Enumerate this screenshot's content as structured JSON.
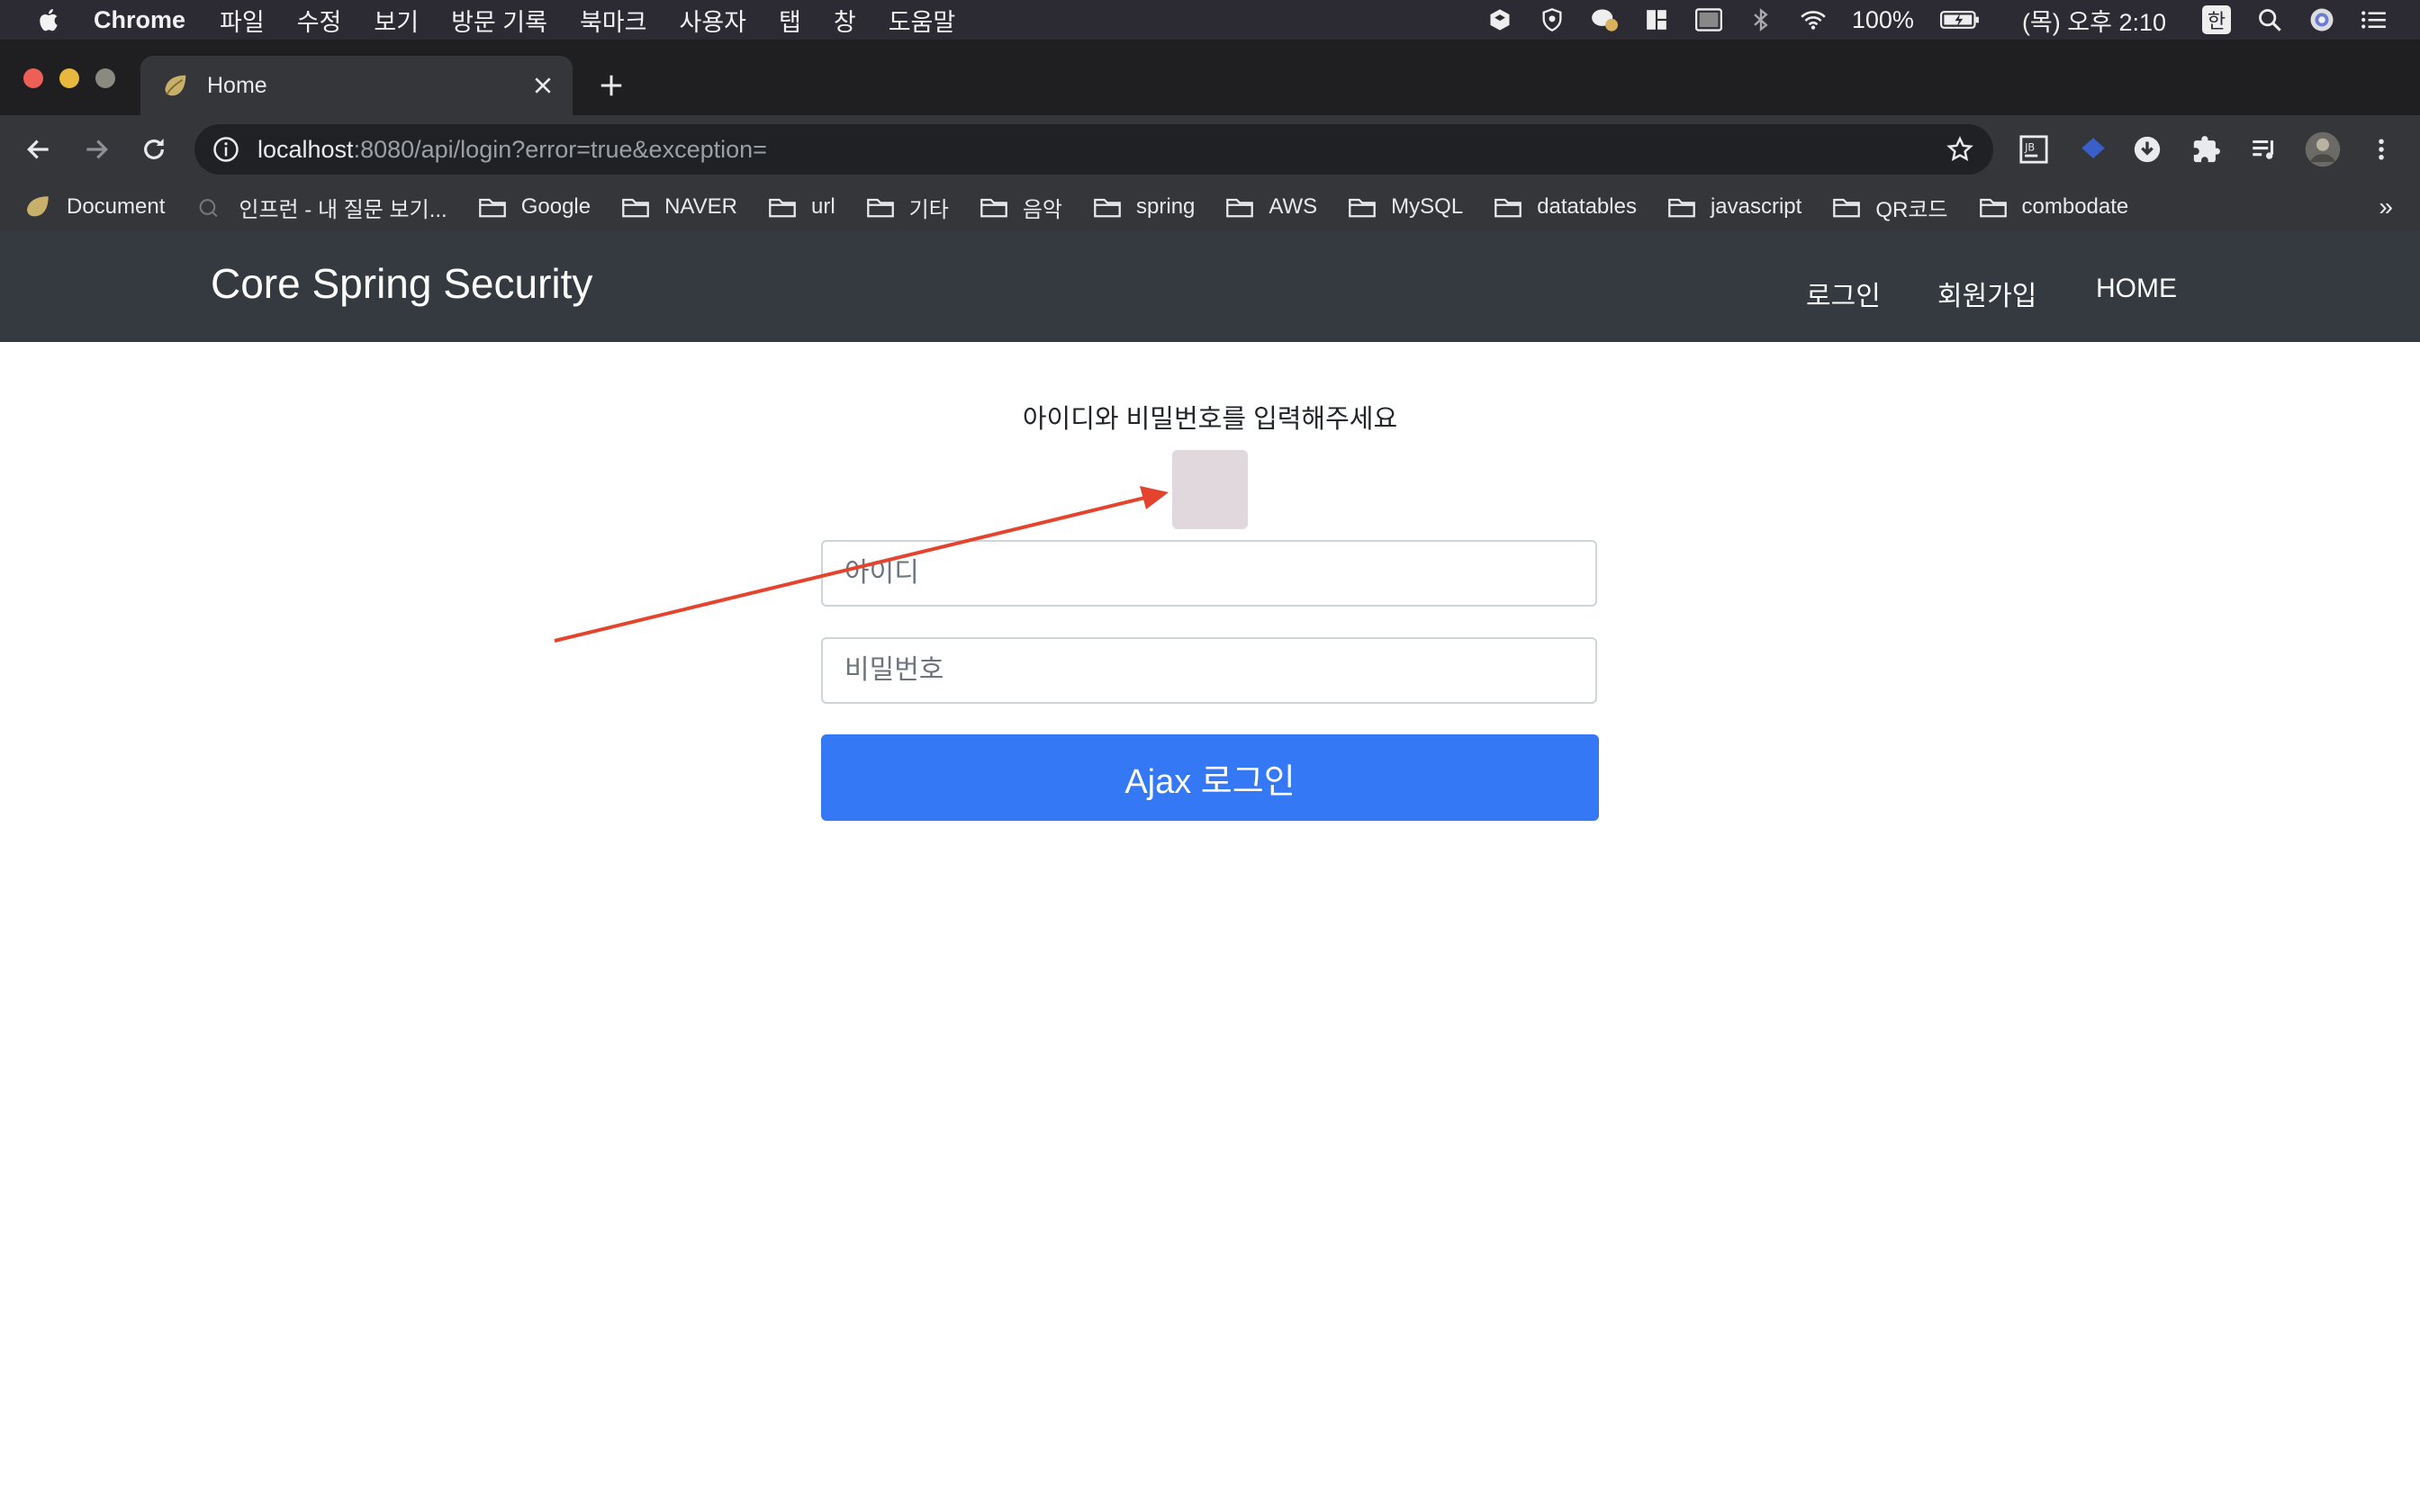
{
  "menubar": {
    "app": "Chrome",
    "items": [
      "파일",
      "수정",
      "보기",
      "방문 기록",
      "북마크",
      "사용자",
      "탭",
      "창",
      "도움말"
    ],
    "battery": "100%",
    "clock": "(목) 오후 2:10",
    "input_source": "한"
  },
  "tab": {
    "title": "Home"
  },
  "omnibox": {
    "host": "localhost",
    "path": ":8080/api/login?error=true&exception="
  },
  "bookmarks": [
    "Document",
    "인프런 - 내 질문 보기...",
    "Google",
    "NAVER",
    "url",
    "기타",
    "음악",
    "spring",
    "AWS",
    "MySQL",
    "datatables",
    "javascript",
    "QR코드",
    "combodate"
  ],
  "bookmarks_more": "»",
  "navbar": {
    "brand": "Core Spring Security",
    "links": [
      "로그인",
      "회원가입",
      "HOME"
    ]
  },
  "form": {
    "message": "아이디와 비밀번호를 입력해주세요",
    "username_placeholder": "아이디",
    "password_placeholder": "비밀번호",
    "submit_label": "Ajax 로그인"
  },
  "colors": {
    "navbar_bg": "#343a40",
    "primary_button": "#3478f6",
    "annotation_arrow": "#e4432d"
  }
}
